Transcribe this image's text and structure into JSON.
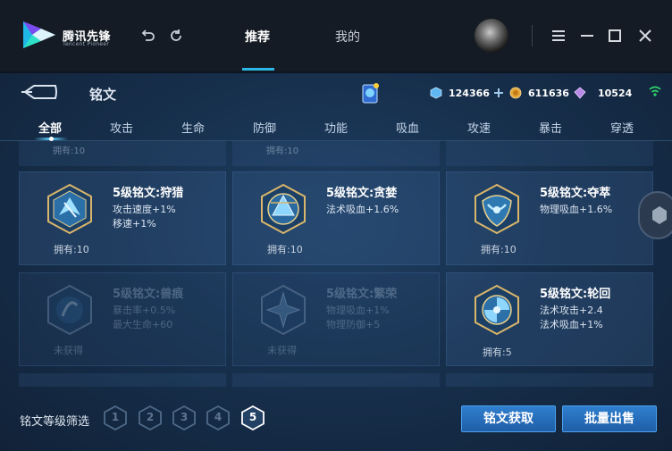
{
  "app": {
    "logo_name": "腾讯先锋",
    "logo_sub": "Tencent Pioneer"
  },
  "nav": {
    "tabs": [
      {
        "label": "推荐",
        "active": true
      },
      {
        "label": "我的",
        "active": false
      }
    ]
  },
  "page": {
    "title": "铭文"
  },
  "currencies": [
    {
      "icon": "diamond-coupon-icon",
      "value": "124366",
      "color": "#5fb6f0"
    },
    {
      "icon": "gold-coin-icon",
      "value": "611636",
      "color": "#e3a73a"
    },
    {
      "icon": "purple-crystal-icon",
      "value": "10524",
      "color": "#b88ae8"
    }
  ],
  "categories": [
    "全部",
    "攻击",
    "生命",
    "防御",
    "功能",
    "吸血",
    "攻速",
    "暴击",
    "穿透"
  ],
  "active_category": "全部",
  "top_partial": {
    "owned_text": "拥有:10"
  },
  "runes": [
    {
      "name": "5级铭文:狩猎",
      "attrs": [
        "攻击速度+1%",
        "移速+1%"
      ],
      "owned": "拥有:10",
      "locked": false,
      "color": "#6ec6ff"
    },
    {
      "name": "5级铭文:贪婪",
      "attrs": [
        "法术吸血+1.6%"
      ],
      "owned": "拥有:10",
      "locked": false,
      "color": "#5fb7f5"
    },
    {
      "name": "5级铭文:夺萃",
      "attrs": [
        "物理吸血+1.6%"
      ],
      "owned": "拥有:10",
      "locked": false,
      "color": "#6fd2ff"
    },
    {
      "name": "5级铭文:兽痕",
      "attrs": [
        "暴击率+0.5%",
        "最大生命+60"
      ],
      "owned": "未获得",
      "locked": true,
      "color": "#6ec6ff"
    },
    {
      "name": "5级铭文:繁荣",
      "attrs": [
        "物理吸血+1%",
        "物理防御+5"
      ],
      "owned": "未获得",
      "locked": true,
      "color": "#6ec6ff"
    },
    {
      "name": "5级铭文:轮回",
      "attrs": [
        "法术攻击+2.4",
        "法术吸血+1%"
      ],
      "owned": "拥有:5",
      "locked": false,
      "color": "#7dd0ff"
    }
  ],
  "footer": {
    "filter_label": "铭文等级筛选",
    "levels": [
      {
        "n": "1",
        "active": false
      },
      {
        "n": "2",
        "active": false
      },
      {
        "n": "3",
        "active": false
      },
      {
        "n": "4",
        "active": false
      },
      {
        "n": "5",
        "active": true
      }
    ],
    "get_button": "铭文获取",
    "sell_button": "批量出售"
  }
}
